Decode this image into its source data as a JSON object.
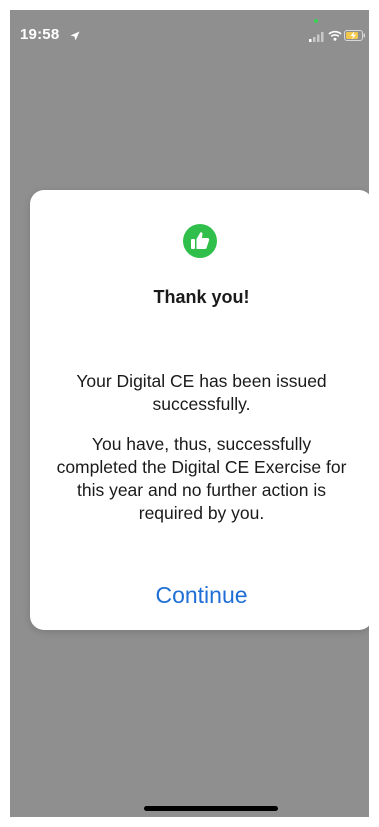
{
  "status_bar": {
    "time": "19:58"
  },
  "dialog": {
    "title": "Thank you!",
    "message_1": "Your Digital CE has been issued successfully.",
    "message_2": "You have, thus, successfully completed the Digital CE Exercise for this year and no further action is required by you.",
    "continue_label": "Continue",
    "icon": "thumbs-up-icon"
  },
  "colors": {
    "overlay": "#8f8f8f",
    "accent": "#1f6fd6",
    "success": "#2fbf4a"
  }
}
